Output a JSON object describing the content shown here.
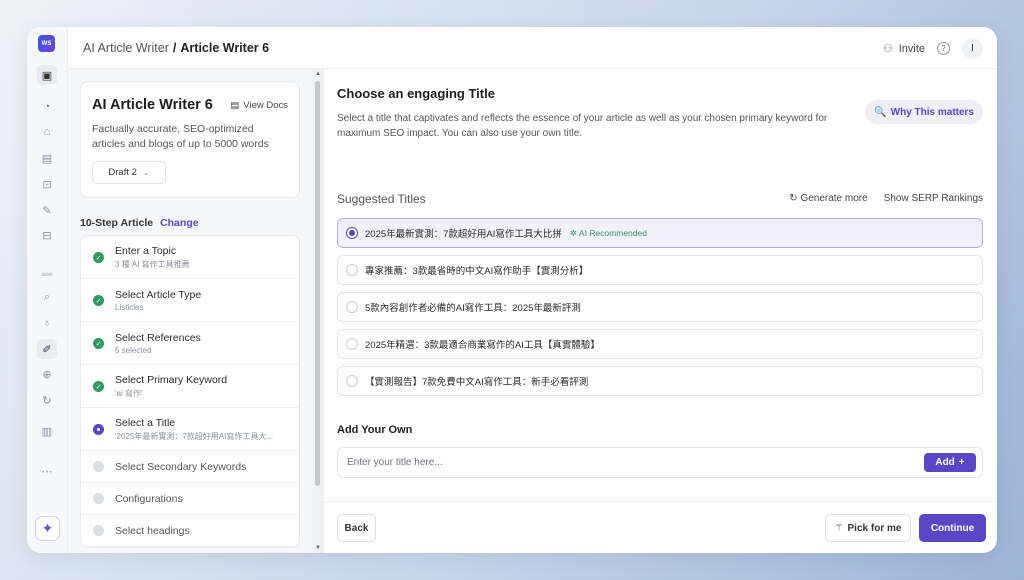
{
  "header": {
    "breadcrumb_parent": "AI Article Writer",
    "breadcrumb_sep": "/",
    "breadcrumb_current": "Article Writer 6",
    "invite_label": "Invite",
    "avatar_initial": "I"
  },
  "sidebar_rail": {
    "logo_text": "WS",
    "icons": [
      "image-icon",
      "spinner-icon",
      "home-icon",
      "document-icon",
      "ai-icon",
      "feather-icon",
      "robot-icon",
      "search-icon",
      "lightbulb-icon",
      "pen-icon",
      "upload-icon",
      "refresh-icon",
      "chart-icon",
      "more-icon",
      "sparkle-icon"
    ]
  },
  "left_panel": {
    "title": "AI Article Writer 6",
    "view_docs": "View Docs",
    "description": "Factually accurate, SEO-optimized articles and blogs of up to 5000 words",
    "draft_label": "Draft 2",
    "steps_header": "10-Step Article",
    "change_label": "Change",
    "steps": [
      {
        "label": "Enter a Topic",
        "sub": "3 種 AI 寫作工具推薦",
        "status": "done"
      },
      {
        "label": "Select Article Type",
        "sub": "Listicles",
        "status": "done"
      },
      {
        "label": "Select References",
        "sub": "5 selected",
        "status": "done"
      },
      {
        "label": "Select Primary Keyword",
        "sub": "'ai 寫作'",
        "status": "done"
      },
      {
        "label": "Select a Title",
        "sub": "'2025年最新實測：7款超好用AI寫作工具大...",
        "status": "current"
      },
      {
        "label": "Select Secondary Keywords",
        "sub": "",
        "status": "todo"
      },
      {
        "label": "Configurations",
        "sub": "",
        "status": "todo"
      },
      {
        "label": "Select headings",
        "sub": "",
        "status": "todo"
      }
    ]
  },
  "main": {
    "heading": "Choose an engaging Title",
    "description": "Select a title that captivates and reflects the essence of your article as well as your chosen primary keyword for maximum SEO impact. You can also use your own title.",
    "why_label": "Why This matters",
    "suggested_header": "Suggested Titles",
    "generate_more": "Generate more",
    "show_serp": "Show SERP Rankings",
    "ai_recommended": "AI Recommended",
    "titles": [
      "2025年最新實測：7款超好用AI寫作工具大比拼",
      "專家推薦：3款最省時的中文AI寫作助手【實測分析】",
      "5款內容創作者必備的AI寫作工具：2025年最新評測",
      "2025年精選：3款最適合商業寫作的AI工具【真實體驗】",
      "【實測報告】7款免費中文AI寫作工具：新手必看評測"
    ],
    "selected_index": 0,
    "add_own_header": "Add Your Own",
    "own_placeholder": "Enter your title here...",
    "own_value": "",
    "add_label": "Add",
    "back_label": "Back",
    "pick_label": "Pick for me",
    "continue_label": "Continue"
  },
  "colors": {
    "accent": "#5b45c7",
    "done_green": "#2f9a5d",
    "selected_bg": "#f2f0fb"
  }
}
